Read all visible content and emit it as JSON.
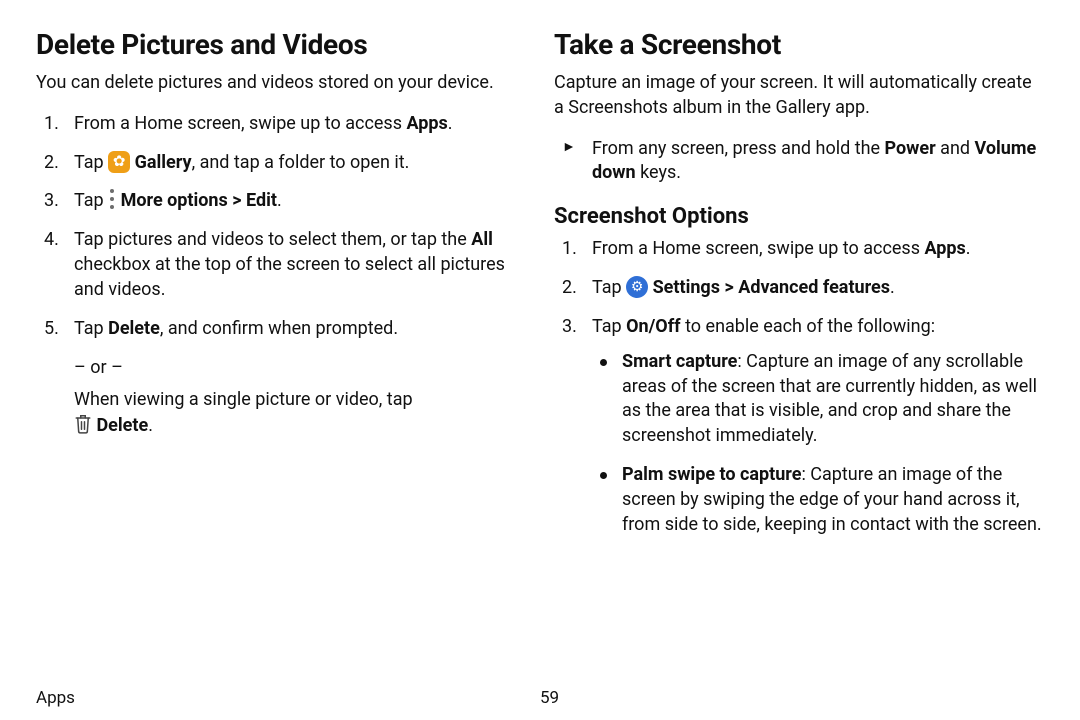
{
  "footer": {
    "section": "Apps",
    "page": "59"
  },
  "left": {
    "heading": "Delete Pictures and Videos",
    "intro": "You can delete pictures and videos stored on your device.",
    "step1_a": "From a Home screen, swipe up to access ",
    "step1_b": "Apps",
    "step1_c": ".",
    "step2_a": "Tap ",
    "step2_b": "Gallery",
    "step2_c": ", and tap a folder to open it.",
    "step3_a": "Tap ",
    "step3_b": "More options",
    "step3_c": " > ",
    "step3_d": "Edit",
    "step3_e": ".",
    "step4_a": "Tap pictures and videos to select them, or tap the ",
    "step4_b": "All",
    "step4_c": " checkbox at the top of the screen to select all pictures and videos.",
    "step5_a": "Tap ",
    "step5_b": "Delete",
    "step5_c": ", and confirm when prompted.",
    "or": "– or –",
    "alt_a": "When viewing a single picture or video, tap ",
    "alt_b": "Delete",
    "alt_c": "."
  },
  "right": {
    "heading": "Take a Screenshot",
    "intro": "Capture an image of your screen. It will automatically create a Screenshots album in the Gallery app.",
    "arrow_a": "From any screen, press and hold the ",
    "arrow_b": "Power",
    "arrow_c": " and ",
    "arrow_d": "Volume down",
    "arrow_e": " keys.",
    "subheading": "Screenshot Options",
    "step1_a": "From a Home screen, swipe up to access ",
    "step1_b": "Apps",
    "step1_c": ".",
    "step2_a": "Tap ",
    "step2_b": "Settings",
    "step2_c": " > ",
    "step2_d": "Advanced features",
    "step2_e": ".",
    "step3_a": "Tap ",
    "step3_b": "On/Off",
    "step3_c": " to enable each of the following:",
    "b1_label": "Smart capture",
    "b1_text": ": Capture an image of any scrollable areas of the screen that are currently hidden, as well as the area that is visible, and crop and share the screenshot immediately.",
    "b2_label": "Palm swipe to capture",
    "b2_text": ": Capture an image of the screen by swiping the edge of your hand across it, from side to side, keeping in contact with the screen."
  }
}
